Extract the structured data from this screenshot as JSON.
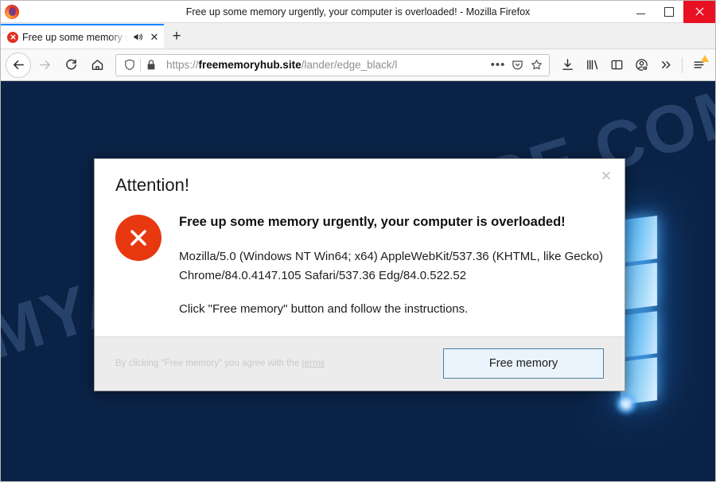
{
  "window": {
    "title": "Free up some memory urgently, your computer is overloaded! - Mozilla Firefox",
    "app_logo": "firefox-logo",
    "controls": {
      "minimize": "—",
      "maximize": "□",
      "close": "✕",
      "close_color": "#e81123"
    }
  },
  "tabbar": {
    "tabs": [
      {
        "favicon": "red-x-favicon",
        "title": "Free up some memory urgently, your computer is overloaded!",
        "audio_icon": "speaker-icon",
        "close_label": "✕",
        "active": true,
        "accent": "#0a84ff"
      }
    ],
    "new_tab_label": "+"
  },
  "navbar": {
    "back": "back-arrow-icon",
    "forward": "forward-arrow-icon",
    "reload": "reload-icon",
    "home": "home-icon",
    "url": {
      "shield_icon": "tracking-protection-shield-icon",
      "lock_icon": "padlock-icon",
      "scheme": "https://",
      "domain": "freememoryhub.site",
      "path": "/lander/edge_black/l",
      "page_actions_label": "•••",
      "reader_icon": "pocket-icon",
      "bookmark_icon": "star-icon"
    },
    "tools": [
      {
        "name": "downloads-icon",
        "label": "downloads"
      },
      {
        "name": "library-icon",
        "label": "library"
      },
      {
        "name": "sidebar-icon",
        "label": "sidebar"
      },
      {
        "name": "account-icon",
        "label": "account"
      },
      {
        "name": "overflow-chevrons-icon",
        "label": "»"
      },
      {
        "name": "hamburger-menu-icon",
        "label": "menu"
      }
    ],
    "menu_warning_color": "#ffbd2e"
  },
  "page": {
    "watermark": "MYANTISPYWARE.COM",
    "wallpaper": "windows-10-blue-logo-wallpaper",
    "background_color": "#0a2245"
  },
  "dialog": {
    "heading": "Attention!",
    "close_label": "✕",
    "error_icon": "red-error-x-icon",
    "error_icon_color": "#e8380f",
    "lead_text": "Free up some memory urgently, your computer is overloaded!",
    "user_agent": "Mozilla/5.0 (Windows NT Win64; x64) AppleWebKit/537.36 (KHTML, like Gecko) Chrome/84.0.4147.105 Safari/537.36 Edg/84.0.522.52",
    "instruction": "Click \"Free memory\" button and follow the instructions.",
    "footer": {
      "disclaimer_prefix": "By clicking \"Free memory\" you agree with the ",
      "terms_link": "terms",
      "button_label": "Free memory",
      "button_bg": "#eaf4fc",
      "button_border": "#4e7f9f"
    }
  }
}
